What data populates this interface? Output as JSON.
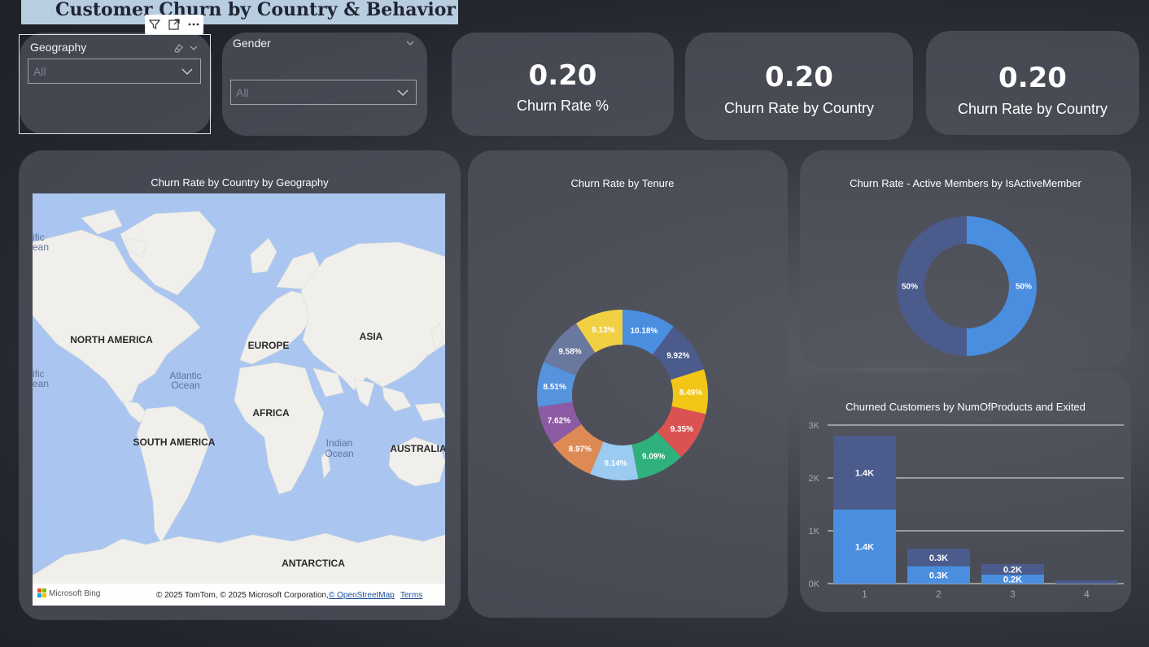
{
  "report": {
    "title": "Customer Churn by Country & Behavior"
  },
  "visual_toolbar": {
    "icons": [
      "filter-icon",
      "focus-mode-icon",
      "more-options-icon"
    ]
  },
  "slicers": [
    {
      "label": "Geography",
      "value": "All"
    },
    {
      "label": "Gender",
      "value": "All"
    }
  ],
  "kpis": [
    {
      "value": "0.20",
      "label": "Churn Rate %"
    },
    {
      "value": "0.20",
      "label": "Churn Rate by Country"
    },
    {
      "value": "0.20",
      "label": "Churn Rate by Country"
    }
  ],
  "map": {
    "title": "Churn Rate by Country by Geography",
    "labels": {
      "north_america": "NORTH AMERICA",
      "europe": "EUROPE",
      "asia": "ASIA",
      "atlantic_1": "Atlantic",
      "atlantic_2": "Ocean",
      "africa": "AFRICA",
      "south_america": "SOUTH AMERICA",
      "indian_1": "Indian",
      "indian_2": "Ocean",
      "australia": "AUSTRALIA",
      "antarctica": "ANTARCTICA",
      "edge_top_1": "ific",
      "edge_top_2": "ean",
      "edge_mid_1": "ific",
      "edge_mid_2": "ean"
    },
    "brand": "Microsoft Bing",
    "attribution": "© 2025 TomTom, © 2025 Microsoft Corporation,",
    "osm_link": "© OpenStreetMap",
    "terms_link": "Terms",
    "colors": {
      "water": "#aac6f0",
      "land": "#f0efec"
    }
  },
  "chart_data": [
    {
      "type": "pie",
      "title": "Churn Rate by Tenure",
      "slices": [
        {
          "label": "10.18%",
          "value": 10.18,
          "color": "#4a8ee0"
        },
        {
          "label": "9.92%",
          "value": 9.92,
          "color": "#4b5b8c"
        },
        {
          "label": "8.49%",
          "value": 8.49,
          "color": "#f2c617"
        },
        {
          "label": "9.35%",
          "value": 9.35,
          "color": "#db5252"
        },
        {
          "label": "9.09%",
          "value": 9.09,
          "color": "#2fb07c"
        },
        {
          "label": "9.14%",
          "value": 9.14,
          "color": "#9bcbf0"
        },
        {
          "label": "8.97%",
          "value": 8.97,
          "color": "#de8a55"
        },
        {
          "label": "7.62%",
          "value": 7.62,
          "color": "#8d5ba3"
        },
        {
          "label": "8.51%",
          "value": 8.51,
          "color": "#5693dd"
        },
        {
          "label": "9.58%",
          "value": 9.58,
          "color": "#6a78a0"
        },
        {
          "label": "9.13%",
          "value": 9.13,
          "color": "#f2d044"
        }
      ]
    },
    {
      "type": "pie",
      "title": "Churn Rate - Active Members by IsActiveMember",
      "slices": [
        {
          "label": "50%",
          "value": 50,
          "color": "#4a8ee0"
        },
        {
          "label": "50%",
          "value": 50,
          "color": "#4b5b8c"
        }
      ]
    },
    {
      "type": "bar",
      "stacked": true,
      "title": "Churned Customers by NumOfProducts and Exited",
      "categories": [
        "1",
        "2",
        "3",
        "4"
      ],
      "series": [
        {
          "values": [
            1400,
            330,
            170,
            0
          ],
          "labels": [
            "1.4K",
            "0.3K",
            "0.2K",
            ""
          ],
          "color": "#4a8ee0"
        },
        {
          "values": [
            1400,
            330,
            200,
            60
          ],
          "labels": [
            "1.4K",
            "0.3K",
            "0.2K",
            ""
          ],
          "color": "#4b5b8c"
        }
      ],
      "ylim": [
        0,
        3000
      ],
      "yticks": [
        "0K",
        "1K",
        "2K",
        "3K"
      ],
      "grid": true
    }
  ]
}
